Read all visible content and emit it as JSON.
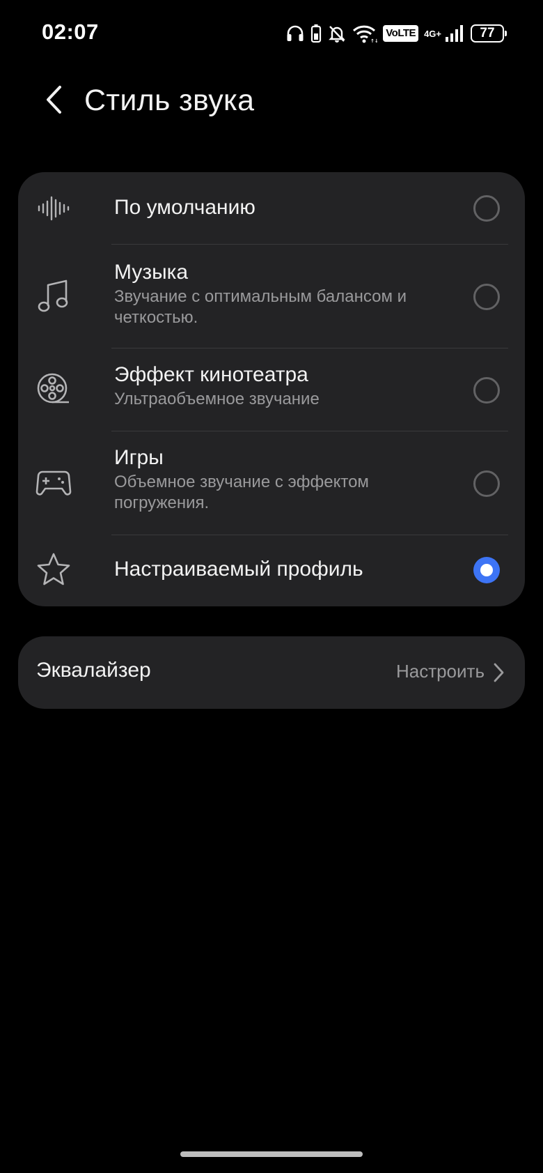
{
  "status_bar": {
    "time": "02:07",
    "volte": "VoLTE",
    "network": "4G+",
    "battery": "77",
    "icons": [
      "headphones-icon",
      "battery-saver-icon",
      "mute-icon",
      "wifi-icon",
      "volte-icon",
      "signal-icon",
      "battery-icon"
    ]
  },
  "header": {
    "title": "Стиль звука",
    "back_icon": "chevron-left-icon"
  },
  "options": [
    {
      "icon": "waveform-icon",
      "title": "По умолчанию",
      "subtitle": "",
      "selected": false
    },
    {
      "icon": "music-note-icon",
      "title": "Музыка",
      "subtitle": "Звучание с оптимальным балансом и четкостью.",
      "selected": false
    },
    {
      "icon": "film-reel-icon",
      "title": "Эффект кинотеатра",
      "subtitle": "Ультраобъемное звучание",
      "selected": false
    },
    {
      "icon": "gamepad-icon",
      "title": "Игры",
      "subtitle": "Объемное звучание с эффектом погружения.",
      "selected": false
    },
    {
      "icon": "star-icon",
      "title": "Настраиваемый профиль",
      "subtitle": "",
      "selected": true
    }
  ],
  "equalizer": {
    "title": "Эквалайзер",
    "value": "Настроить",
    "icon": "chevron-right-icon"
  },
  "colors": {
    "background": "#000000",
    "card": "#232325",
    "accent": "#3d74f5",
    "secondary_text": "#9a9a9c"
  }
}
